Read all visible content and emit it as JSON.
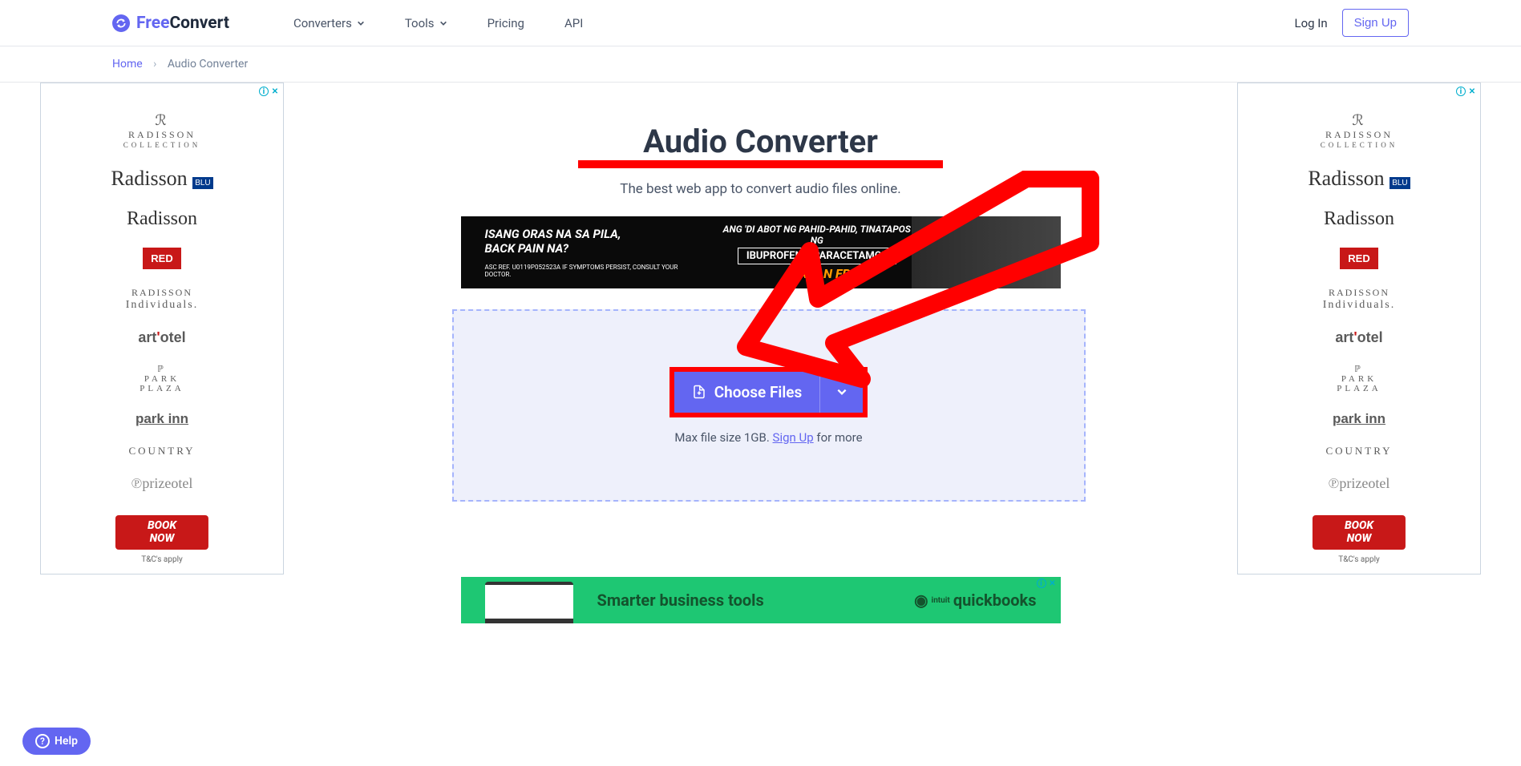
{
  "header": {
    "logo_free": "Free",
    "logo_convert": "Convert",
    "nav": {
      "converters": "Converters",
      "tools": "Tools",
      "pricing": "Pricing",
      "api": "API"
    },
    "login": "Log In",
    "signup": "Sign Up"
  },
  "breadcrumb": {
    "home": "Home",
    "current": "Audio Converter"
  },
  "page": {
    "title": "Audio Converter",
    "subtitle": "The best web app to convert audio files online."
  },
  "dropzone": {
    "choose_label": "Choose Files",
    "hint_prefix": "Max file size 1GB. ",
    "signup_link": "Sign Up",
    "hint_suffix": " for more"
  },
  "banner_ad": {
    "line1": "ISANG ORAS NA SA PILA,",
    "line2": "BACK PAIN NA?",
    "ref": "ASC REF. U0119P052523A    IF SYMPTOMS PERSIST, CONSULT YOUR DOCTOR.",
    "right1": "ANG 'DI ABOT NG PAHID-PAHID, TINATAPOS NG",
    "right2": "IBUPROFEN + PARACETAMOL",
    "brand": "ALAXAN FR"
  },
  "side_ad": {
    "brands": {
      "rc_name": "RADISSON",
      "rc_sub": "COLLECTION",
      "blu": "Radisson",
      "rad": "Radisson",
      "red": "RED",
      "ind1": "RADISSON",
      "ind2": "Individuals.",
      "artotel_pre": "art",
      "artotel_post": "otel",
      "park1": "PARK",
      "park2": "PLAZA",
      "parkinn": "park inn",
      "country": "COUNTRY",
      "prize": "prizeotel"
    },
    "book_line1": "BOOK",
    "book_line2": "NOW",
    "tc": "T&C's apply"
  },
  "bottom_ad": {
    "text": "Smarter business tools",
    "brand": "quickbooks",
    "prefix": "intuit"
  },
  "help": {
    "label": "Help"
  }
}
